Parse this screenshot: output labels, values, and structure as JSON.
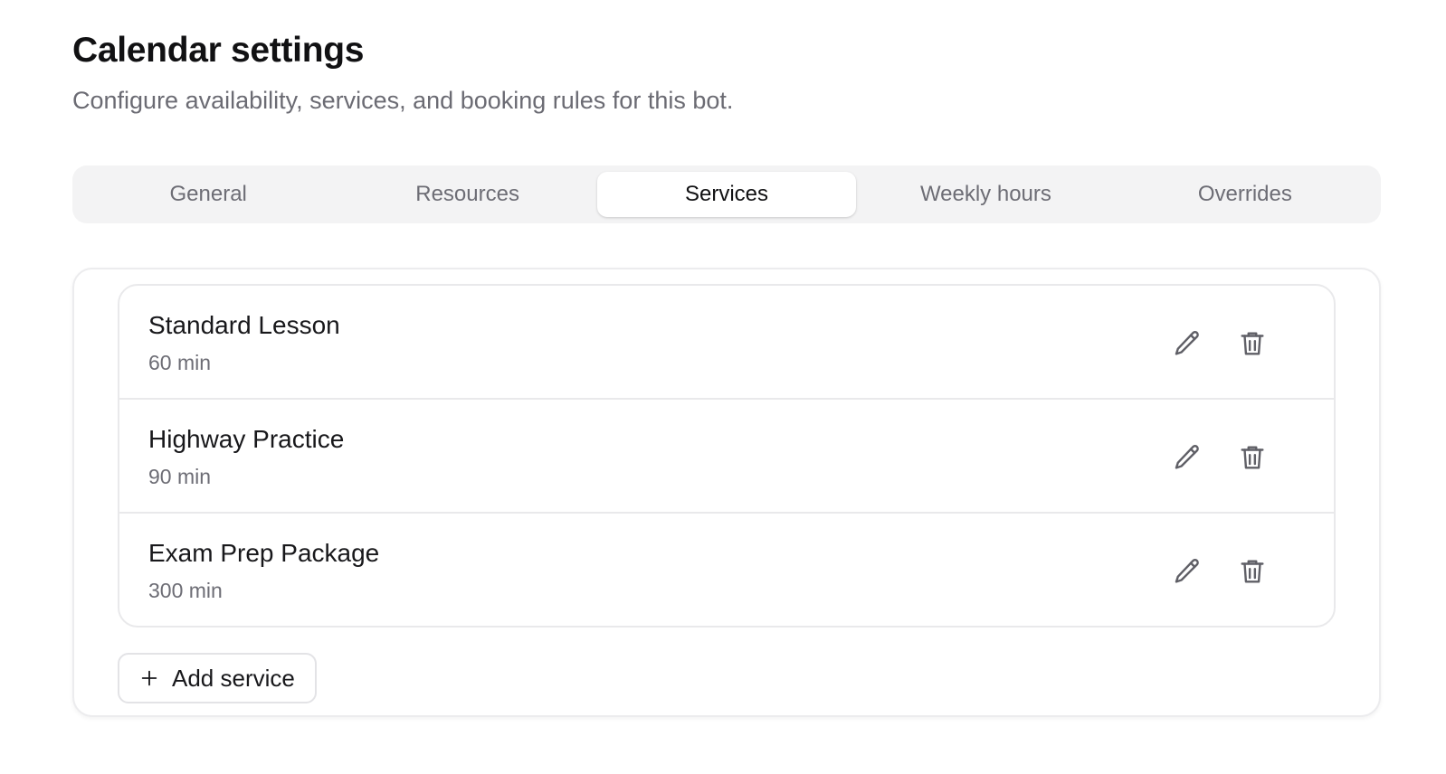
{
  "header": {
    "title": "Calendar settings",
    "subtitle": "Configure availability, services, and booking rules for this bot."
  },
  "tabs": [
    {
      "label": "General",
      "active": false
    },
    {
      "label": "Resources",
      "active": false
    },
    {
      "label": "Services",
      "active": true
    },
    {
      "label": "Weekly hours",
      "active": false
    },
    {
      "label": "Overrides",
      "active": false
    }
  ],
  "services": [
    {
      "name": "Standard Lesson",
      "duration": "60 min"
    },
    {
      "name": "Highway Practice",
      "duration": "90 min"
    },
    {
      "name": "Exam Prep Package",
      "duration": "300 min"
    }
  ],
  "actions": {
    "add_service_label": "Add service"
  },
  "icons": {
    "edit": "pencil-icon",
    "delete": "trash-icon",
    "add": "plus-icon"
  },
  "colors": {
    "tab_bar_bg": "#f3f3f4",
    "active_tab_bg": "#ffffff",
    "muted_text": "#6d6d75",
    "border": "#e9e9eb"
  }
}
